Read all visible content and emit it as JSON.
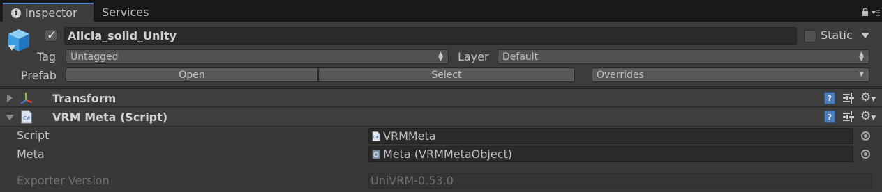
{
  "tabs": [
    {
      "label": "Inspector",
      "icon": "info-icon",
      "active": true
    },
    {
      "label": "Services",
      "active": false
    }
  ],
  "header": {
    "object_name": "Alicia_solid_Unity",
    "active_checked": true,
    "static_label": "Static",
    "static_checked": false,
    "tag_label": "Tag",
    "tag_value": "Untagged",
    "layer_label": "Layer",
    "layer_value": "Default",
    "prefab_label": "Prefab",
    "prefab_open": "Open",
    "prefab_select": "Select",
    "prefab_overrides": "Overrides"
  },
  "components": [
    {
      "title": "Transform",
      "icon": "transform-icon",
      "expanded": false
    },
    {
      "title": "VRM Meta (Script)",
      "icon": "csharp-script-icon",
      "expanded": true
    }
  ],
  "properties": [
    {
      "label": "Script",
      "value": "VRMMeta",
      "icon": "csharp-script-icon",
      "enabled": true
    },
    {
      "label": "Meta",
      "value": "Meta (VRMMetaObject)",
      "icon": "scriptable-object-icon",
      "enabled": true
    },
    {
      "label": "Exporter Version",
      "value": "UniVRM-0.53.0",
      "enabled": false
    }
  ],
  "colors": {
    "background": "#383838",
    "tabbar": "#191919",
    "accent": "#4c7fc4",
    "help_icon": "#4a7cba"
  }
}
